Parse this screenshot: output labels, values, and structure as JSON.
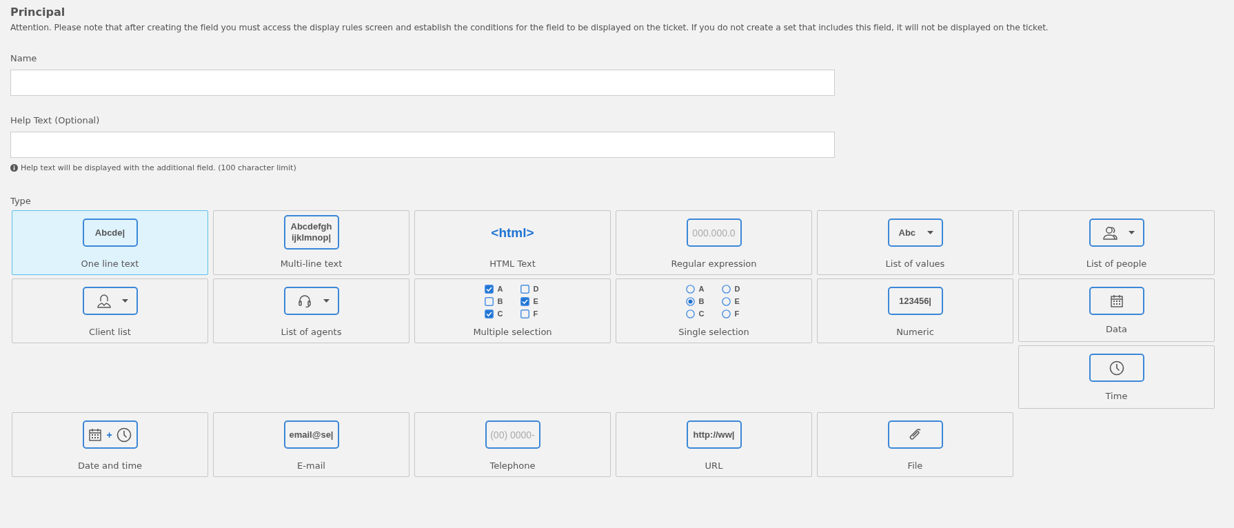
{
  "section": {
    "title": "Principal",
    "notice": "Attention. Please note that after creating the field you must access the display rules screen and establish the conditions for the field to be displayed on the ticket. If you do not create a set that includes this field, it will not be displayed on the ticket."
  },
  "fields": [
    {
      "label": "Name"
    },
    {
      "label": "Help Text (Optional)",
      "hint": "Help text will be displayed with the additional field. (100 character limit)"
    }
  ],
  "type": {
    "label": "Type",
    "options": [
      {
        "kind": "text",
        "sample": "Abcde|",
        "label": "One line text",
        "selected": true
      },
      {
        "kind": "multiline",
        "lines": [
          "Abcdefgh",
          "ijklmnop|"
        ],
        "label": "Multi-line text",
        "selected": false
      },
      {
        "kind": "html",
        "sample": "<html>",
        "label": "HTML Text",
        "selected": false
      },
      {
        "kind": "placeholder",
        "sample": "000.000.0",
        "label": "Regular expression",
        "selected": false
      },
      {
        "kind": "dropdown",
        "sample": "Abc",
        "label": "List of values",
        "selected": false
      },
      {
        "kind": "people",
        "label": "List of people",
        "selected": false
      },
      {
        "kind": "client",
        "label": "Client list",
        "selected": false
      },
      {
        "kind": "agent",
        "label": "List of agents",
        "selected": false
      },
      {
        "kind": "checkboxes",
        "choices": [
          {
            "letter": "A",
            "checked": true
          },
          {
            "letter": "B",
            "checked": false
          },
          {
            "letter": "C",
            "checked": true
          },
          {
            "letter": "D",
            "checked": false
          },
          {
            "letter": "E",
            "checked": true
          },
          {
            "letter": "F",
            "checked": false
          }
        ],
        "label": "Multiple selection",
        "selected": false
      },
      {
        "kind": "radios",
        "choices": [
          {
            "letter": "A",
            "selected": false
          },
          {
            "letter": "B",
            "selected": true
          },
          {
            "letter": "C",
            "selected": false
          },
          {
            "letter": "D",
            "selected": false
          },
          {
            "letter": "E",
            "selected": false
          },
          {
            "letter": "F",
            "selected": false
          }
        ],
        "label": "Single selection",
        "selected": false
      },
      {
        "kind": "text",
        "sample": "123456|",
        "label": "Numeric",
        "selected": false
      },
      {
        "kind": "calendar",
        "label": "Data",
        "selected": false
      },
      {
        "kind": "clock",
        "label": "Time",
        "selected": false
      },
      {
        "kind": "datetime",
        "sample": "+",
        "label": "Date and time",
        "selected": false
      },
      {
        "kind": "text",
        "sample": "email@se|",
        "label": "E-mail",
        "selected": false
      },
      {
        "kind": "placeholder",
        "sample": "(00) 0000-",
        "label": "Telephone",
        "selected": false
      },
      {
        "kind": "text",
        "sample": "http://ww|",
        "label": "URL",
        "selected": false
      },
      {
        "kind": "clip",
        "label": "File",
        "selected": false
      }
    ]
  }
}
